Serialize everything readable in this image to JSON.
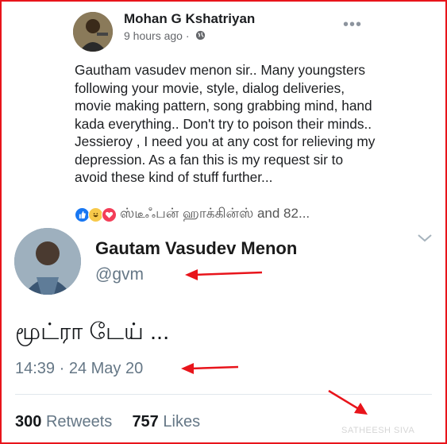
{
  "facebook_post": {
    "author": "Mohan G Kshatriyan",
    "time": "9 hours ago",
    "separator": "·",
    "more": "•••",
    "privacy_icon": "globe-icon",
    "body": "Gautham vasudev menon sir.. Many youngsters following your movie, style, dialog deliveries, movie making pattern, song grabbing mind, hand kada everything.. Don't try to poison their minds.. Jessieroy , I need you at any cost for relieving my depression. As a fan this is my request sir to avoid these kind of stuff further...",
    "reactions": {
      "icons": [
        "like-icon",
        "haha-icon",
        "love-icon"
      ],
      "text": "ஸ்டீஃபன் ஹாக்கின்ஸ் and 82..."
    }
  },
  "tweet": {
    "name": "Gautam Vasudev Menon",
    "handle": "@gvm",
    "text": "மூட்ரா டேய் ...",
    "timestamp": "14:39 · 24 May 20",
    "retweets_count": "300",
    "retweets_label": "Retweets",
    "likes_count": "757",
    "likes_label": "Likes"
  },
  "watermark": "SATHEESH SIVA",
  "colors": {
    "frame_border": "#e8141b",
    "annotation_arrow": "#e8141b",
    "twitter_gray": "#657786",
    "facebook_blue": "#1877f2"
  }
}
